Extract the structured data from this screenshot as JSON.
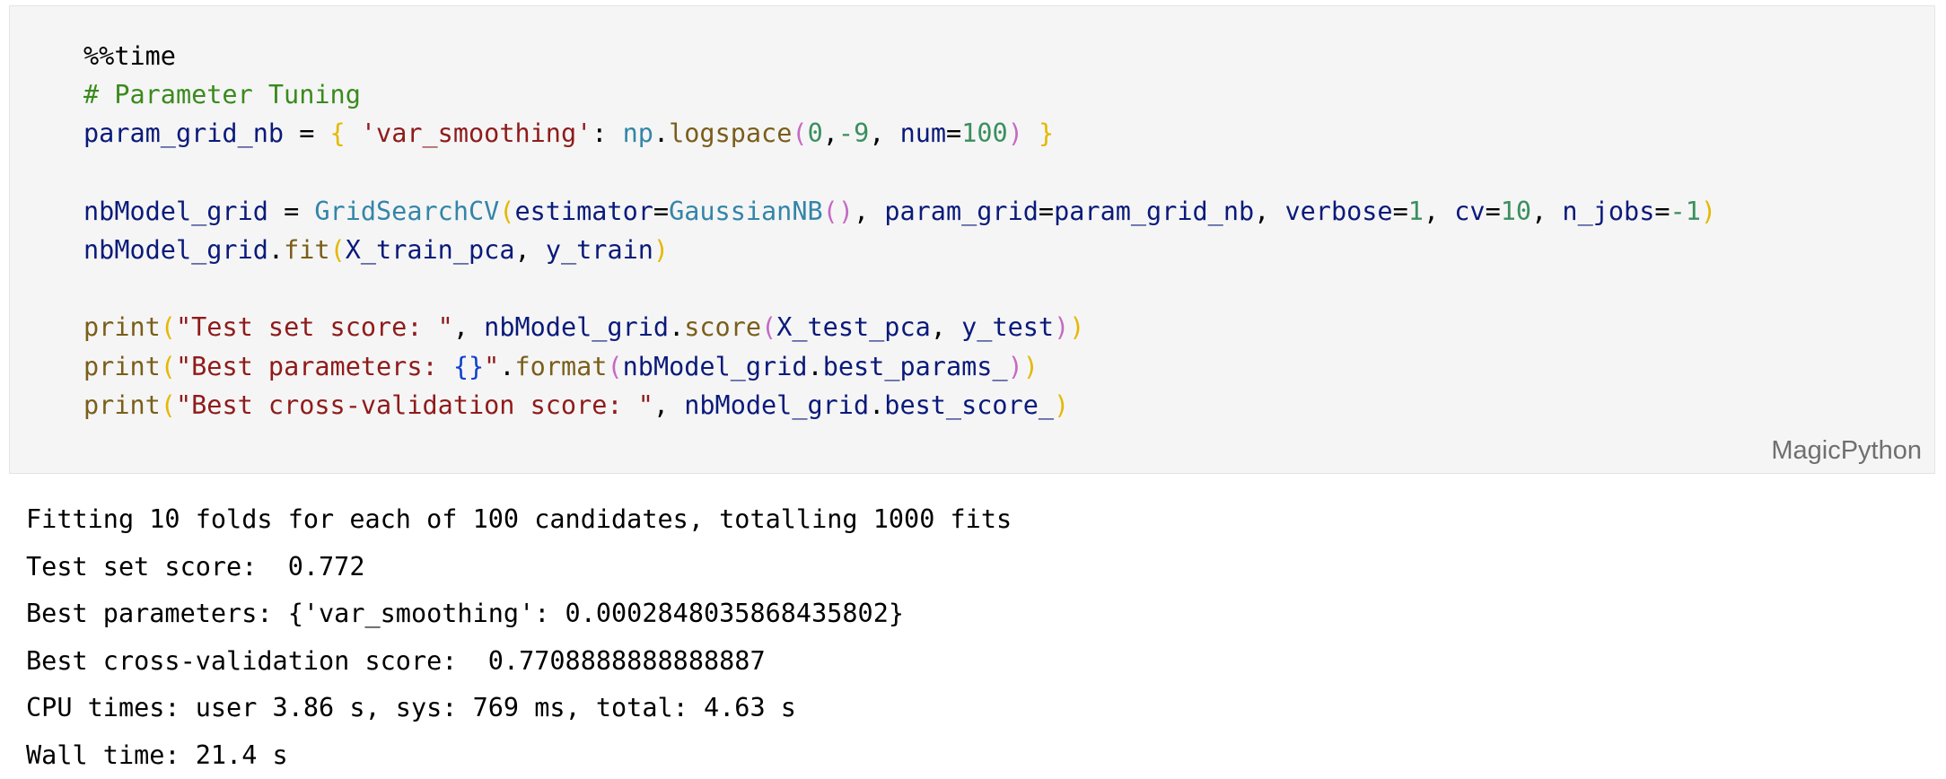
{
  "code_cell": {
    "language_label": "MagicPython",
    "lines": [
      [
        {
          "t": "%%time",
          "c": "magic"
        }
      ],
      [
        {
          "t": "# Parameter Tuning",
          "c": "comment"
        }
      ],
      [
        {
          "t": "param_grid_nb",
          "c": "name"
        },
        {
          "t": " = ",
          "c": "op"
        },
        {
          "t": "{",
          "c": "brace"
        },
        {
          "t": " ",
          "c": "op"
        },
        {
          "t": "'var_smoothing'",
          "c": "string"
        },
        {
          "t": ": ",
          "c": "op"
        },
        {
          "t": "np",
          "c": "module"
        },
        {
          "t": ".",
          "c": "op"
        },
        {
          "t": "logspace",
          "c": "func"
        },
        {
          "t": "(",
          "c": "paren-p"
        },
        {
          "t": "0",
          "c": "number"
        },
        {
          "t": ",",
          "c": "op"
        },
        {
          "t": "-9",
          "c": "number"
        },
        {
          "t": ", ",
          "c": "op"
        },
        {
          "t": "num",
          "c": "name"
        },
        {
          "t": "=",
          "c": "op"
        },
        {
          "t": "100",
          "c": "number"
        },
        {
          "t": ")",
          "c": "paren-p"
        },
        {
          "t": " ",
          "c": "op"
        },
        {
          "t": "}",
          "c": "brace"
        }
      ],
      [],
      [
        {
          "t": "nbModel_grid",
          "c": "name"
        },
        {
          "t": " = ",
          "c": "op"
        },
        {
          "t": "GridSearchCV",
          "c": "class"
        },
        {
          "t": "(",
          "c": "paren-y"
        },
        {
          "t": "estimator",
          "c": "name"
        },
        {
          "t": "=",
          "c": "op"
        },
        {
          "t": "GaussianNB",
          "c": "class"
        },
        {
          "t": "()",
          "c": "paren-p"
        },
        {
          "t": ", ",
          "c": "op"
        },
        {
          "t": "param_grid",
          "c": "name"
        },
        {
          "t": "=",
          "c": "op"
        },
        {
          "t": "param_grid_nb",
          "c": "name"
        },
        {
          "t": ", ",
          "c": "op"
        },
        {
          "t": "verbose",
          "c": "name"
        },
        {
          "t": "=",
          "c": "op"
        },
        {
          "t": "1",
          "c": "number"
        },
        {
          "t": ", ",
          "c": "op"
        },
        {
          "t": "cv",
          "c": "name"
        },
        {
          "t": "=",
          "c": "op"
        },
        {
          "t": "10",
          "c": "number"
        },
        {
          "t": ", ",
          "c": "op"
        },
        {
          "t": "n_jobs",
          "c": "name"
        },
        {
          "t": "=",
          "c": "op"
        },
        {
          "t": "-1",
          "c": "number"
        },
        {
          "t": ")",
          "c": "paren-y"
        }
      ],
      [
        {
          "t": "nbModel_grid",
          "c": "name"
        },
        {
          "t": ".",
          "c": "op"
        },
        {
          "t": "fit",
          "c": "func"
        },
        {
          "t": "(",
          "c": "paren-y"
        },
        {
          "t": "X_train_pca",
          "c": "name"
        },
        {
          "t": ", ",
          "c": "op"
        },
        {
          "t": "y_train",
          "c": "name"
        },
        {
          "t": ")",
          "c": "paren-y"
        }
      ],
      [],
      [
        {
          "t": "print",
          "c": "builtin"
        },
        {
          "t": "(",
          "c": "paren-y"
        },
        {
          "t": "\"Test set score: \"",
          "c": "string"
        },
        {
          "t": ", ",
          "c": "op"
        },
        {
          "t": "nbModel_grid",
          "c": "name"
        },
        {
          "t": ".",
          "c": "op"
        },
        {
          "t": "score",
          "c": "func"
        },
        {
          "t": "(",
          "c": "paren-p"
        },
        {
          "t": "X_test_pca",
          "c": "name"
        },
        {
          "t": ", ",
          "c": "op"
        },
        {
          "t": "y_test",
          "c": "name"
        },
        {
          "t": ")",
          "c": "paren-p"
        },
        {
          "t": ")",
          "c": "paren-y"
        }
      ],
      [
        {
          "t": "print",
          "c": "builtin"
        },
        {
          "t": "(",
          "c": "paren-y"
        },
        {
          "t": "\"Best parameters: ",
          "c": "string"
        },
        {
          "t": "{}",
          "c": "fmtbrace"
        },
        {
          "t": "\"",
          "c": "string"
        },
        {
          "t": ".",
          "c": "op"
        },
        {
          "t": "format",
          "c": "func"
        },
        {
          "t": "(",
          "c": "paren-p"
        },
        {
          "t": "nbModel_grid",
          "c": "name"
        },
        {
          "t": ".",
          "c": "op"
        },
        {
          "t": "best_params_",
          "c": "name"
        },
        {
          "t": ")",
          "c": "paren-p"
        },
        {
          "t": ")",
          "c": "paren-y"
        }
      ],
      [
        {
          "t": "print",
          "c": "builtin"
        },
        {
          "t": "(",
          "c": "paren-y"
        },
        {
          "t": "\"Best cross-validation score: \"",
          "c": "string"
        },
        {
          "t": ", ",
          "c": "op"
        },
        {
          "t": "nbModel_grid",
          "c": "name"
        },
        {
          "t": ".",
          "c": "op"
        },
        {
          "t": "best_score_",
          "c": "name"
        },
        {
          "t": ")",
          "c": "paren-y"
        }
      ]
    ]
  },
  "output": {
    "lines": [
      "Fitting 10 folds for each of 100 candidates, totalling 1000 fits",
      "Test set score:  0.772",
      "Best parameters: {'var_smoothing': 0.0002848035868435802}",
      "Best cross-validation score:  0.7708888888888887",
      "CPU times: user 3.86 s, sys: 769 ms, total: 4.63 s",
      "Wall time: 21.4 s"
    ]
  }
}
